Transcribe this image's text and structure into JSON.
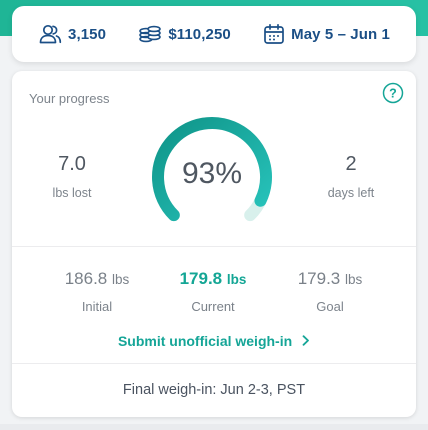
{
  "stats": {
    "participants": "3,150",
    "pot": "$110,250",
    "dates": "May 5 – Jun 1"
  },
  "progress": {
    "title": "Your progress",
    "percent_text": "93%",
    "percent_value": 93,
    "lost_value": "7.0",
    "lost_label": "lbs lost",
    "days_value": "2",
    "days_label": "days left"
  },
  "weights": {
    "initial_value": "186.8",
    "initial_unit": "lbs",
    "initial_label": "Initial",
    "current_value": "179.8",
    "current_unit": "lbs",
    "current_label": "Current",
    "goal_value": "179.3",
    "goal_unit": "lbs",
    "goal_label": "Goal"
  },
  "submit_label": "Submit unofficial weigh-in",
  "final_weigh_in": "Final weigh-in: Jun 2-3, PST",
  "colors": {
    "brand": "#1fb596",
    "accent_teal": "#15a597",
    "navy": "#1b4f86",
    "gauge_track": "#d8f0ec"
  },
  "icons": [
    "users-icon",
    "money-stack-icon",
    "calendar-icon",
    "help-icon",
    "chevron-right-icon"
  ]
}
